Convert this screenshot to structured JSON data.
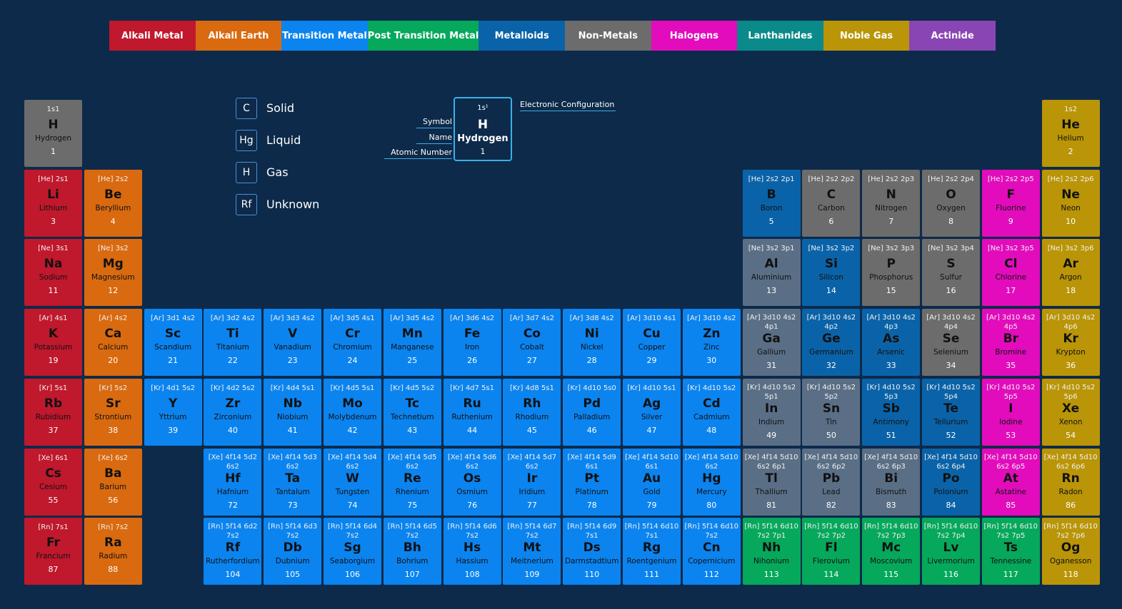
{
  "categories": [
    {
      "key": "alkali",
      "label": "Alkali Metal",
      "color": "#c0182d"
    },
    {
      "key": "earth",
      "label": "Alkali Earth",
      "color": "#d96a10"
    },
    {
      "key": "transition",
      "label": "Transition Metal",
      "color": "#0b84f0"
    },
    {
      "key": "post",
      "label": "Post Transition Metal",
      "color": "#06a85c"
    },
    {
      "key": "metalloid",
      "label": "Metalloids",
      "color": "#0a63a8"
    },
    {
      "key": "nonmetal",
      "label": "Non-Metals",
      "color": "#6c6c6c"
    },
    {
      "key": "halogen",
      "label": "Halogens",
      "color": "#e20cbc"
    },
    {
      "key": "lanthanide",
      "label": "Lanthanides",
      "color": "#0a8a8a"
    },
    {
      "key": "noble",
      "label": "Noble Gas",
      "color": "#b99507"
    },
    {
      "key": "actinide",
      "label": "Actinide",
      "color": "#8a45b4"
    }
  ],
  "post_transition_blue_gray": "#5a6f86",
  "states": [
    {
      "symbol": "C",
      "label": "Solid"
    },
    {
      "symbol": "Hg",
      "label": "Liquid"
    },
    {
      "symbol": "H",
      "label": "Gas"
    },
    {
      "symbol": "Rf",
      "label": "Unknown"
    }
  ],
  "key": {
    "config": "1s¹",
    "symbol": "H",
    "name": "Hydrogen",
    "number": "1",
    "label_config": "Electronic Configuration",
    "label_symbol": "Symbol",
    "label_name": "Name",
    "label_number": "Atomic Number"
  },
  "elements": [
    {
      "n": 1,
      "s": "H",
      "name": "Hydrogen",
      "cfg": "1s1",
      "r": 1,
      "c": 1,
      "cat": "nonmetal"
    },
    {
      "n": 2,
      "s": "He",
      "name": "Helium",
      "cfg": "1s2",
      "r": 1,
      "c": 18,
      "cat": "noble"
    },
    {
      "n": 3,
      "s": "Li",
      "name": "Lithium",
      "cfg": "[He] 2s1",
      "r": 2,
      "c": 1,
      "cat": "alkali"
    },
    {
      "n": 4,
      "s": "Be",
      "name": "Beryllium",
      "cfg": "[He] 2s2",
      "r": 2,
      "c": 2,
      "cat": "earth"
    },
    {
      "n": 5,
      "s": "B",
      "name": "Boron",
      "cfg": "[He] 2s2 2p1",
      "r": 2,
      "c": 13,
      "cat": "metalloid"
    },
    {
      "n": 6,
      "s": "C",
      "name": "Carbon",
      "cfg": "[He] 2s2 2p2",
      "r": 2,
      "c": 14,
      "cat": "nonmetal"
    },
    {
      "n": 7,
      "s": "N",
      "name": "Nitrogen",
      "cfg": "[He] 2s2 2p3",
      "r": 2,
      "c": 15,
      "cat": "nonmetal"
    },
    {
      "n": 8,
      "s": "O",
      "name": "Oxygen",
      "cfg": "[He] 2s2 2p4",
      "r": 2,
      "c": 16,
      "cat": "nonmetal"
    },
    {
      "n": 9,
      "s": "F",
      "name": "Fluorine",
      "cfg": "[He] 2s2 2p5",
      "r": 2,
      "c": 17,
      "cat": "halogen"
    },
    {
      "n": 10,
      "s": "Ne",
      "name": "Neon",
      "cfg": "[He] 2s2 2p6",
      "r": 2,
      "c": 18,
      "cat": "noble"
    },
    {
      "n": 11,
      "s": "Na",
      "name": "Sodium",
      "cfg": "[Ne] 3s1",
      "r": 3,
      "c": 1,
      "cat": "alkali"
    },
    {
      "n": 12,
      "s": "Mg",
      "name": "Magnesium",
      "cfg": "[Ne] 3s2",
      "r": 3,
      "c": 2,
      "cat": "earth"
    },
    {
      "n": 13,
      "s": "Al",
      "name": "Aluminium",
      "cfg": "[Ne] 3s2 3p1",
      "r": 3,
      "c": 13,
      "cat": "ptbg"
    },
    {
      "n": 14,
      "s": "Si",
      "name": "Silicon",
      "cfg": "[Ne] 3s2 3p2",
      "r": 3,
      "c": 14,
      "cat": "metalloid"
    },
    {
      "n": 15,
      "s": "P",
      "name": "Phosphorus",
      "cfg": "[Ne] 3s2 3p3",
      "r": 3,
      "c": 15,
      "cat": "nonmetal"
    },
    {
      "n": 16,
      "s": "S",
      "name": "Sulfur",
      "cfg": "[Ne] 3s2 3p4",
      "r": 3,
      "c": 16,
      "cat": "nonmetal"
    },
    {
      "n": 17,
      "s": "Cl",
      "name": "Chlorine",
      "cfg": "[Ne] 3s2 3p5",
      "r": 3,
      "c": 17,
      "cat": "halogen"
    },
    {
      "n": 18,
      "s": "Ar",
      "name": "Argon",
      "cfg": "[Ne] 3s2 3p6",
      "r": 3,
      "c": 18,
      "cat": "noble"
    },
    {
      "n": 19,
      "s": "K",
      "name": "Potassium",
      "cfg": "[Ar] 4s1",
      "r": 4,
      "c": 1,
      "cat": "alkali"
    },
    {
      "n": 20,
      "s": "Ca",
      "name": "Calcium",
      "cfg": "[Ar] 4s2",
      "r": 4,
      "c": 2,
      "cat": "earth"
    },
    {
      "n": 21,
      "s": "Sc",
      "name": "Scandium",
      "cfg": "[Ar] 3d1 4s2",
      "r": 4,
      "c": 3,
      "cat": "transition"
    },
    {
      "n": 22,
      "s": "Ti",
      "name": "Titanium",
      "cfg": "[Ar] 3d2 4s2",
      "r": 4,
      "c": 4,
      "cat": "transition"
    },
    {
      "n": 23,
      "s": "V",
      "name": "Vanadium",
      "cfg": "[Ar] 3d3 4s2",
      "r": 4,
      "c": 5,
      "cat": "transition"
    },
    {
      "n": 24,
      "s": "Cr",
      "name": "Chromium",
      "cfg": "[Ar] 3d5 4s1",
      "r": 4,
      "c": 6,
      "cat": "transition"
    },
    {
      "n": 25,
      "s": "Mn",
      "name": "Manganese",
      "cfg": "[Ar] 3d5 4s2",
      "r": 4,
      "c": 7,
      "cat": "transition"
    },
    {
      "n": 26,
      "s": "Fe",
      "name": "Iron",
      "cfg": "[Ar] 3d6 4s2",
      "r": 4,
      "c": 8,
      "cat": "transition"
    },
    {
      "n": 27,
      "s": "Co",
      "name": "Cobalt",
      "cfg": "[Ar] 3d7 4s2",
      "r": 4,
      "c": 9,
      "cat": "transition"
    },
    {
      "n": 28,
      "s": "Ni",
      "name": "Nickel",
      "cfg": "[Ar] 3d8 4s2",
      "r": 4,
      "c": 10,
      "cat": "transition"
    },
    {
      "n": 29,
      "s": "Cu",
      "name": "Copper",
      "cfg": "[Ar] 3d10 4s1",
      "r": 4,
      "c": 11,
      "cat": "transition"
    },
    {
      "n": 30,
      "s": "Zn",
      "name": "Zinc",
      "cfg": "[Ar] 3d10 4s2",
      "r": 4,
      "c": 12,
      "cat": "transition"
    },
    {
      "n": 31,
      "s": "Ga",
      "name": "Gallium",
      "cfg": "[Ar] 3d10 4s2 4p1",
      "r": 4,
      "c": 13,
      "cat": "ptbg"
    },
    {
      "n": 32,
      "s": "Ge",
      "name": "Germanium",
      "cfg": "[Ar] 3d10 4s2 4p2",
      "r": 4,
      "c": 14,
      "cat": "metalloid"
    },
    {
      "n": 33,
      "s": "As",
      "name": "Arsenic",
      "cfg": "[Ar] 3d10 4s2 4p3",
      "r": 4,
      "c": 15,
      "cat": "metalloid"
    },
    {
      "n": 34,
      "s": "Se",
      "name": "Selenium",
      "cfg": "[Ar] 3d10 4s2 4p4",
      "r": 4,
      "c": 16,
      "cat": "nonmetal"
    },
    {
      "n": 35,
      "s": "Br",
      "name": "Bromine",
      "cfg": "[Ar] 3d10 4s2 4p5",
      "r": 4,
      "c": 17,
      "cat": "halogen"
    },
    {
      "n": 36,
      "s": "Kr",
      "name": "Krypton",
      "cfg": "[Ar] 3d10 4s2 4p6",
      "r": 4,
      "c": 18,
      "cat": "noble"
    },
    {
      "n": 37,
      "s": "Rb",
      "name": "Rubidium",
      "cfg": "[Kr] 5s1",
      "r": 5,
      "c": 1,
      "cat": "alkali"
    },
    {
      "n": 38,
      "s": "Sr",
      "name": "Strontium",
      "cfg": "[Kr] 5s2",
      "r": 5,
      "c": 2,
      "cat": "earth"
    },
    {
      "n": 39,
      "s": "Y",
      "name": "Yttrium",
      "cfg": "[Kr] 4d1 5s2",
      "r": 5,
      "c": 3,
      "cat": "transition"
    },
    {
      "n": 40,
      "s": "Zr",
      "name": "Zirconium",
      "cfg": "[Kr] 4d2 5s2",
      "r": 5,
      "c": 4,
      "cat": "transition"
    },
    {
      "n": 41,
      "s": "Nb",
      "name": "Niobium",
      "cfg": "[Kr] 4d4 5s1",
      "r": 5,
      "c": 5,
      "cat": "transition"
    },
    {
      "n": 42,
      "s": "Mo",
      "name": "Molybdenum",
      "cfg": "[Kr] 4d5 5s1",
      "r": 5,
      "c": 6,
      "cat": "transition"
    },
    {
      "n": 43,
      "s": "Tc",
      "name": "Technetium",
      "cfg": "[Kr] 4d5 5s2",
      "r": 5,
      "c": 7,
      "cat": "transition"
    },
    {
      "n": 44,
      "s": "Ru",
      "name": "Ruthenium",
      "cfg": "[Kr] 4d7 5s1",
      "r": 5,
      "c": 8,
      "cat": "transition"
    },
    {
      "n": 45,
      "s": "Rh",
      "name": "Rhodium",
      "cfg": "[Kr] 4d8 5s1",
      "r": 5,
      "c": 9,
      "cat": "transition"
    },
    {
      "n": 46,
      "s": "Pd",
      "name": "Palladium",
      "cfg": "[Kr] 4d10 5s0",
      "r": 5,
      "c": 10,
      "cat": "transition"
    },
    {
      "n": 47,
      "s": "Ag",
      "name": "Silver",
      "cfg": "[Kr] 4d10 5s1",
      "r": 5,
      "c": 11,
      "cat": "transition"
    },
    {
      "n": 48,
      "s": "Cd",
      "name": "Cadmium",
      "cfg": "[Kr] 4d10 5s2",
      "r": 5,
      "c": 12,
      "cat": "transition"
    },
    {
      "n": 49,
      "s": "In",
      "name": "Indium",
      "cfg": "[Kr] 4d10 5s2 5p1",
      "r": 5,
      "c": 13,
      "cat": "ptbg"
    },
    {
      "n": 50,
      "s": "Sn",
      "name": "Tin",
      "cfg": "[Kr] 4d10 5s2 5p2",
      "r": 5,
      "c": 14,
      "cat": "ptbg"
    },
    {
      "n": 51,
      "s": "Sb",
      "name": "Antimony",
      "cfg": "[Kr] 4d10 5s2 5p3",
      "r": 5,
      "c": 15,
      "cat": "metalloid"
    },
    {
      "n": 52,
      "s": "Te",
      "name": "Tellurium",
      "cfg": "[Kr] 4d10 5s2 5p4",
      "r": 5,
      "c": 16,
      "cat": "metalloid"
    },
    {
      "n": 53,
      "s": "I",
      "name": "Iodine",
      "cfg": "[Kr] 4d10 5s2 5p5",
      "r": 5,
      "c": 17,
      "cat": "halogen"
    },
    {
      "n": 54,
      "s": "Xe",
      "name": "Xenon",
      "cfg": "[Kr] 4d10 5s2 5p6",
      "r": 5,
      "c": 18,
      "cat": "noble"
    },
    {
      "n": 55,
      "s": "Cs",
      "name": "Cesium",
      "cfg": "[Xe] 6s1",
      "r": 6,
      "c": 1,
      "cat": "alkali"
    },
    {
      "n": 56,
      "s": "Ba",
      "name": "Barium",
      "cfg": "[Xe] 6s2",
      "r": 6,
      "c": 2,
      "cat": "earth"
    },
    {
      "n": 72,
      "s": "Hf",
      "name": "Hafnium",
      "cfg": "[Xe] 4f14 5d2 6s2",
      "r": 6,
      "c": 4,
      "cat": "transition"
    },
    {
      "n": 73,
      "s": "Ta",
      "name": "Tantalum",
      "cfg": "[Xe] 4f14 5d3 6s2",
      "r": 6,
      "c": 5,
      "cat": "transition"
    },
    {
      "n": 74,
      "s": "W",
      "name": "Tungsten",
      "cfg": "[Xe] 4f14 5d4 6s2",
      "r": 6,
      "c": 6,
      "cat": "transition"
    },
    {
      "n": 75,
      "s": "Re",
      "name": "Rhenium",
      "cfg": "[Xe] 4f14 5d5 6s2",
      "r": 6,
      "c": 7,
      "cat": "transition"
    },
    {
      "n": 76,
      "s": "Os",
      "name": "Osmium",
      "cfg": "[Xe] 4f14 5d6 6s2",
      "r": 6,
      "c": 8,
      "cat": "transition"
    },
    {
      "n": 77,
      "s": "Ir",
      "name": "Iridium",
      "cfg": "[Xe] 4f14 5d7 6s2",
      "r": 6,
      "c": 9,
      "cat": "transition"
    },
    {
      "n": 78,
      "s": "Pt",
      "name": "Platinum",
      "cfg": "[Xe] 4f14 5d9 6s1",
      "r": 6,
      "c": 10,
      "cat": "transition"
    },
    {
      "n": 79,
      "s": "Au",
      "name": "Gold",
      "cfg": "[Xe] 4f14 5d10 6s1",
      "r": 6,
      "c": 11,
      "cat": "transition"
    },
    {
      "n": 80,
      "s": "Hg",
      "name": "Mercury",
      "cfg": "[Xe] 4f14 5d10 6s2",
      "r": 6,
      "c": 12,
      "cat": "transition"
    },
    {
      "n": 81,
      "s": "Tl",
      "name": "Thallium",
      "cfg": "[Xe] 4f14 5d10 6s2 6p1",
      "r": 6,
      "c": 13,
      "cat": "ptbg"
    },
    {
      "n": 82,
      "s": "Pb",
      "name": "Lead",
      "cfg": "[Xe] 4f14 5d10 6s2 6p2",
      "r": 6,
      "c": 14,
      "cat": "ptbg"
    },
    {
      "n": 83,
      "s": "Bi",
      "name": "Bismuth",
      "cfg": "[Xe] 4f14 5d10 6s2 6p3",
      "r": 6,
      "c": 15,
      "cat": "ptbg"
    },
    {
      "n": 84,
      "s": "Po",
      "name": "Polonium",
      "cfg": "[Xe] 4f14 5d10 6s2 6p4",
      "r": 6,
      "c": 16,
      "cat": "metalloid"
    },
    {
      "n": 85,
      "s": "At",
      "name": "Astatine",
      "cfg": "[Xe] 4f14 5d10 6s2 6p5",
      "r": 6,
      "c": 17,
      "cat": "halogen"
    },
    {
      "n": 86,
      "s": "Rn",
      "name": "Radon",
      "cfg": "[Xe] 4f14 5d10 6s2 6p6",
      "r": 6,
      "c": 18,
      "cat": "noble"
    },
    {
      "n": 87,
      "s": "Fr",
      "name": "Francium",
      "cfg": "[Rn] 7s1",
      "r": 7,
      "c": 1,
      "cat": "alkali"
    },
    {
      "n": 88,
      "s": "Ra",
      "name": "Radium",
      "cfg": "[Rn] 7s2",
      "r": 7,
      "c": 2,
      "cat": "earth"
    },
    {
      "n": 104,
      "s": "Rf",
      "name": "Rutherfordium",
      "cfg": "[Rn] 5f14 6d2 7s2",
      "r": 7,
      "c": 4,
      "cat": "transition"
    },
    {
      "n": 105,
      "s": "Db",
      "name": "Dubnium",
      "cfg": "[Rn] 5f14 6d3 7s2",
      "r": 7,
      "c": 5,
      "cat": "transition"
    },
    {
      "n": 106,
      "s": "Sg",
      "name": "Seaborgium",
      "cfg": "[Rn] 5f14 6d4 7s2",
      "r": 7,
      "c": 6,
      "cat": "transition"
    },
    {
      "n": 107,
      "s": "Bh",
      "name": "Bohrium",
      "cfg": "[Rn] 5f14 6d5 7s2",
      "r": 7,
      "c": 7,
      "cat": "transition"
    },
    {
      "n": 108,
      "s": "Hs",
      "name": "Hassium",
      "cfg": "[Rn] 5f14 6d6 7s2",
      "r": 7,
      "c": 8,
      "cat": "transition"
    },
    {
      "n": 109,
      "s": "Mt",
      "name": "Meitnerium",
      "cfg": "[Rn] 5f14 6d7 7s2",
      "r": 7,
      "c": 9,
      "cat": "transition"
    },
    {
      "n": 110,
      "s": "Ds",
      "name": "Darmstadtium",
      "cfg": "[Rn] 5f14 6d9 7s1",
      "r": 7,
      "c": 10,
      "cat": "transition"
    },
    {
      "n": 111,
      "s": "Rg",
      "name": "Roentgenium",
      "cfg": "[Rn] 5f14 6d10 7s1",
      "r": 7,
      "c": 11,
      "cat": "transition"
    },
    {
      "n": 112,
      "s": "Cn",
      "name": "Copernicium",
      "cfg": "[Rn] 5f14 6d10 7s2",
      "r": 7,
      "c": 12,
      "cat": "transition"
    },
    {
      "n": 113,
      "s": "Nh",
      "name": "Nihonium",
      "cfg": "[Rn] 5f14 6d10 7s2 7p1",
      "r": 7,
      "c": 13,
      "cat": "post"
    },
    {
      "n": 114,
      "s": "Fl",
      "name": "Flerovium",
      "cfg": "[Rn] 5f14 6d10 7s2 7p2",
      "r": 7,
      "c": 14,
      "cat": "post"
    },
    {
      "n": 115,
      "s": "Mc",
      "name": "Moscovium",
      "cfg": "[Rn] 5f14 6d10 7s2 7p3",
      "r": 7,
      "c": 15,
      "cat": "post"
    },
    {
      "n": 116,
      "s": "Lv",
      "name": "Livermorium",
      "cfg": "[Rn] 5f14 6d10 7s2 7p4",
      "r": 7,
      "c": 16,
      "cat": "post"
    },
    {
      "n": 117,
      "s": "Ts",
      "name": "Tennessine",
      "cfg": "[Rn] 5f14 6d10 7s2 7p5",
      "r": 7,
      "c": 17,
      "cat": "post"
    },
    {
      "n": 118,
      "s": "Og",
      "name": "Oganesson",
      "cfg": "[Rn] 5f14 6d10 7s2 7p6",
      "r": 7,
      "c": 18,
      "cat": "noble"
    }
  ]
}
